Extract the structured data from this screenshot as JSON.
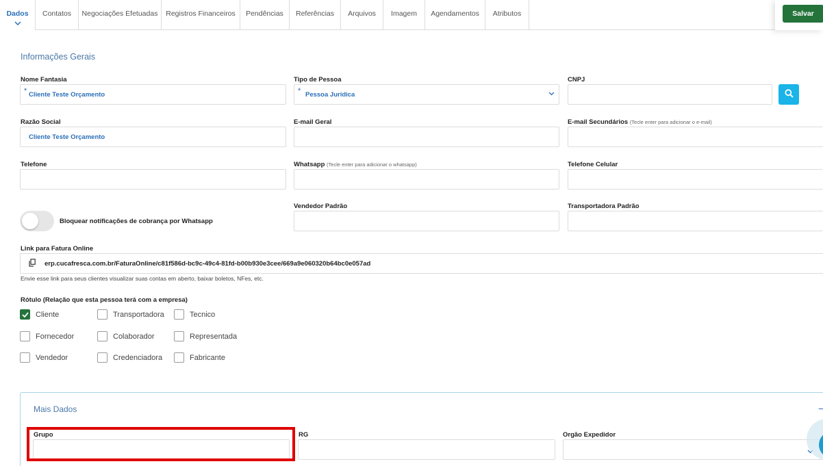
{
  "tabs": [
    {
      "label": "Dados",
      "active": true
    },
    {
      "label": "Contatos"
    },
    {
      "label": "Negociações Efetuadas"
    },
    {
      "label": "Registros Financeiros"
    },
    {
      "label": "Pendências"
    },
    {
      "label": "Referências"
    },
    {
      "label": "Arquivos"
    },
    {
      "label": "Imagem"
    },
    {
      "label": "Agendamentos"
    },
    {
      "label": "Atributos"
    }
  ],
  "toolbar": {
    "save_label": "Salvar"
  },
  "section": {
    "title": "Informações Gerais"
  },
  "fields": {
    "nome_fantasia": {
      "label": "Nome Fantasia",
      "value": "Cliente Teste Orçamento",
      "required": "*"
    },
    "tipo_pessoa": {
      "label": "Tipo de Pessoa",
      "value": "Pessoa Jurídica",
      "required": "*"
    },
    "cnpj": {
      "label": "CNPJ",
      "value": ""
    },
    "razao_social": {
      "label": "Razão Social",
      "value": "Cliente Teste Orçamento"
    },
    "email_geral": {
      "label": "E-mail Geral",
      "value": ""
    },
    "email_secundarios": {
      "label": "E-mail Secundários",
      "hint": "(Tecle enter para adicionar o e-mail)",
      "value": ""
    },
    "telefone": {
      "label": "Telefone",
      "value": ""
    },
    "whatsapp": {
      "label": "Whatsapp",
      "hint": "(Tecle enter para adicionar o whatsapp)",
      "value": ""
    },
    "telefone_celular": {
      "label": "Telefone Celular",
      "value": ""
    },
    "vendedor_padrao": {
      "label": "Vendedor Padrão",
      "value": ""
    },
    "transportadora_padrao": {
      "label": "Transportadora Padrão",
      "value": ""
    }
  },
  "toggle": {
    "label": "Bloquear notificações de cobrança por Whatsapp",
    "on": false
  },
  "link": {
    "label": "Link para Fatura Online",
    "value": "erp.cucafresca.com.br/FaturaOnline/c81f586d-bc9c-49c4-81fd-b00b930e3cee/669a9e060320b64bc0e057ad",
    "help": "Envie esse link para seus clientes visualizar suas contas em aberto, baixar boletos, NFes, etc."
  },
  "rotulo": {
    "label": "Rótulo (Relação que esta pessoa terá com a empresa)",
    "options": [
      {
        "label": "Cliente",
        "checked": true
      },
      {
        "label": "Transportadora",
        "checked": false
      },
      {
        "label": "Tecnico",
        "checked": false
      },
      {
        "label": "Fornecedor",
        "checked": false
      },
      {
        "label": "Colaborador",
        "checked": false
      },
      {
        "label": "Representada",
        "checked": false
      },
      {
        "label": "Vendedor",
        "checked": false
      },
      {
        "label": "Credenciadora",
        "checked": false
      },
      {
        "label": "Fabricante",
        "checked": false
      }
    ]
  },
  "mais_dados": {
    "title": "Mais Dados",
    "collapse_glyph": "−",
    "grupo": {
      "label": "Grupo",
      "value": ""
    },
    "rg": {
      "label": "RG",
      "value": ""
    },
    "orgao_expedidor": {
      "label": "Orgão Expedidor",
      "value": ""
    }
  },
  "icons": {
    "tab_chevron": "chevron-down-icon",
    "select_chevron": "chevron-down-icon",
    "search": "search-icon",
    "copy": "copy-icon",
    "check": "check-icon"
  },
  "colors": {
    "accent_blue": "#2a6fb8",
    "save_green": "#24733b",
    "search_cyan": "#1ab4e8",
    "highlight_red": "#e00000",
    "panel_border": "#a8d4e6"
  }
}
